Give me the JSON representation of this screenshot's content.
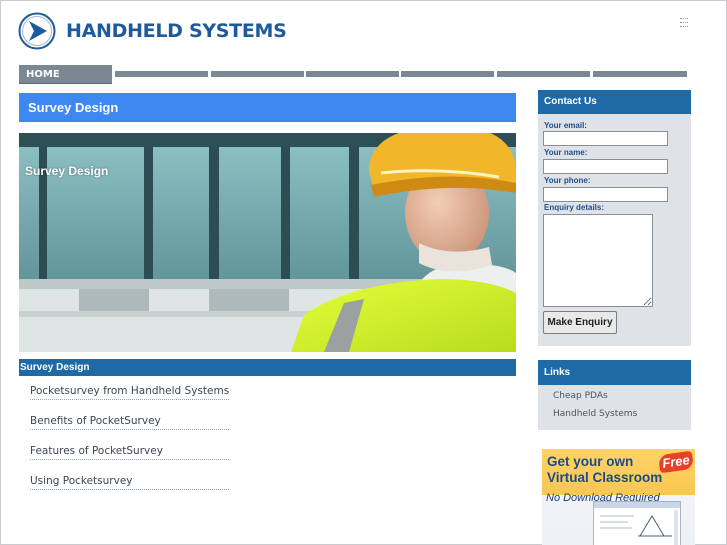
{
  "header": {
    "brand": "HANDHELD SYSTEMS",
    "logo_icon": "arrow-logo-icon"
  },
  "nav": {
    "home_label": "HOME",
    "blank_items": 6
  },
  "main": {
    "page_title": "Survey Design",
    "hero_caption": "Survey Design",
    "section_title": "Survey Design",
    "links": [
      "Pocketsurvey from Handheld Systems",
      "Benefits of PocketSurvey",
      "Features of PocketSurvey",
      "Using Pocketsurvey"
    ]
  },
  "contact": {
    "title": "Contact Us",
    "email_label": "Your email:",
    "name_label": "Your name:",
    "phone_label": "Your phone:",
    "details_label": "Enquiry details:",
    "email_value": "",
    "name_value": "",
    "phone_value": "",
    "details_value": "",
    "submit_label": "Make Enquiry"
  },
  "links_box": {
    "title": "Links",
    "items": [
      "Cheap PDAs",
      "Handheld Systems"
    ]
  },
  "ad": {
    "line1": "Get your own",
    "line2": "Virtual Classroom",
    "badge": "Free",
    "sub": "No Download Required"
  },
  "colors": {
    "brand_blue": "#1f5a9a",
    "title_bar_blue": "#3c87f0",
    "section_blue": "#1d6aa7",
    "nav_gray": "#7b8792",
    "sidebar_bg": "#dfe2e6"
  }
}
